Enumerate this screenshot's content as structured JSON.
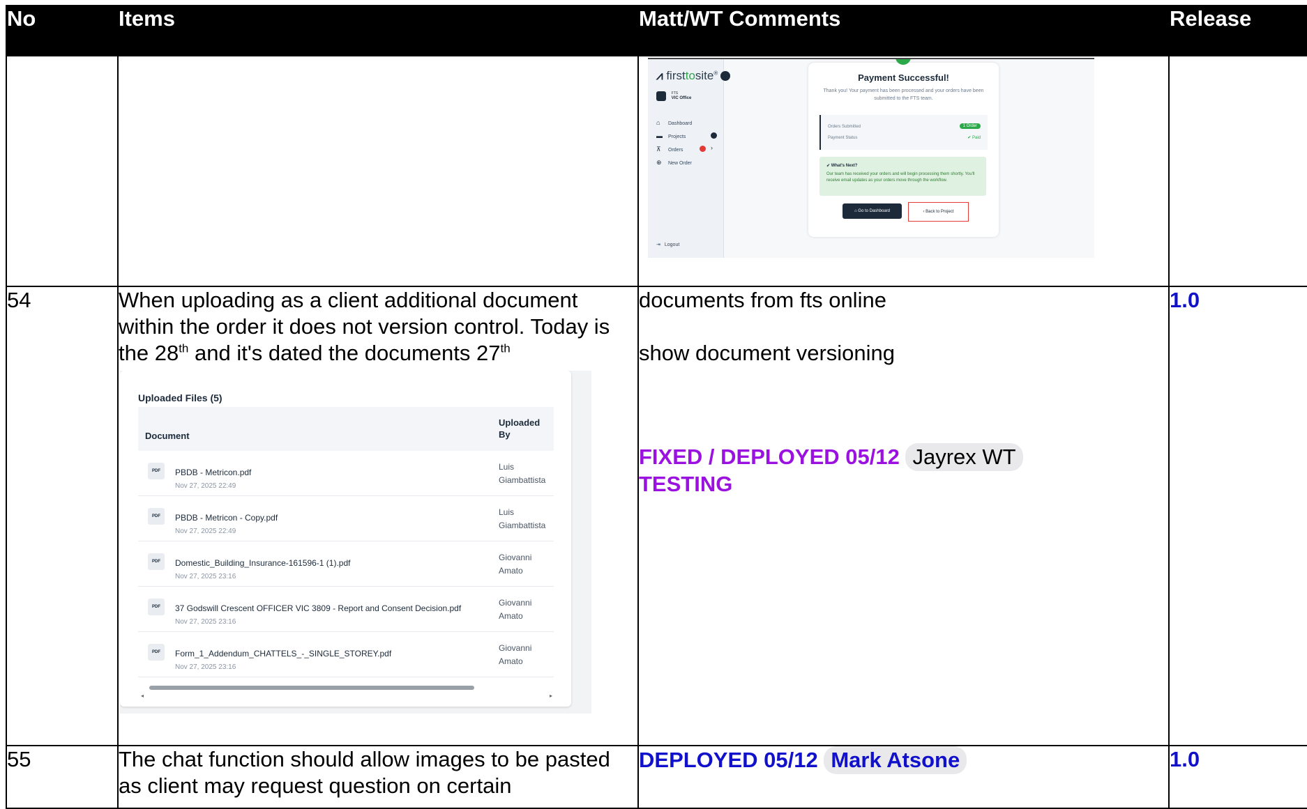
{
  "table": {
    "headers": {
      "no": "No",
      "items": "Items",
      "comments": "Matt/WT Comments",
      "release": "Release"
    }
  },
  "payment_screenshot": {
    "logo_text": "first",
    "logo_accent": "to",
    "logo_rest": "site",
    "logo_reg": "®",
    "office_small": "FTS",
    "office_label": "VIC Office",
    "nav": [
      "Dashboard",
      "Projects",
      "Orders",
      "New Order"
    ],
    "logout": "Logout",
    "title": "Payment Successful!",
    "subtitle": "Thank you! Your payment has been processed and your orders have been submitted to the FTS team.",
    "orders_submitted_label": "Orders Submitted",
    "orders_submitted_value": "1 Order",
    "payment_status_label": "Payment Status",
    "payment_status_value": "Paid",
    "whats_next_title": "What's Next?",
    "whats_next_text": "Our team has received your orders and will begin processing them shortly. You'll receive email updates as your orders move through the workflow.",
    "go_dashboard": "Go to Dashboard",
    "back_project": "Back to Project"
  },
  "rows": [
    {
      "no": "54",
      "item_line1": "When uploading as a client additional document within the order it does not version control. Today is the 28",
      "item_sup1": "th",
      "item_line2": " and it's dated the documents 27",
      "item_sup2": "th",
      "comment1": "documents from fts online",
      "comment2": "show document versioning",
      "status": "FIXED / DEPLOYED 05/12",
      "status_cont": "TESTING",
      "assignee": "Jayrex WT",
      "release": "1.0"
    },
    {
      "no": "55",
      "item": "The chat function should allow images to be pasted as client may request question on certain",
      "status": "DEPLOYED 05/12",
      "assignee": "Mark Atsone",
      "release": "1.0"
    }
  ],
  "files_screenshot": {
    "title": "Uploaded Files (5)",
    "col_document": "Document",
    "col_uploaded_by": "Uploaded By",
    "icon_label": "PDF",
    "files": [
      {
        "name": "PBDB - Metricon.pdf",
        "date": "Nov 27, 2025 22:49",
        "by": "Luis Giambattista"
      },
      {
        "name": "PBDB - Metricon - Copy.pdf",
        "date": "Nov 27, 2025 22:49",
        "by": "Luis Giambattista"
      },
      {
        "name": "Domestic_Building_Insurance-161596-1 (1).pdf",
        "date": "Nov 27, 2025 23:16",
        "by": "Giovanni Amato"
      },
      {
        "name": "37 Godswill Crescent OFFICER VIC 3809 - Report and Consent Decision.pdf",
        "date": "Nov 27, 2025 23:16",
        "by": "Giovanni Amato"
      },
      {
        "name": "Form_1_Addendum_CHATTELS_-_SINGLE_STOREY.pdf",
        "date": "Nov 27, 2025 23:16",
        "by": "Giovanni Amato"
      }
    ]
  },
  "colors": {
    "header_bg": "#000000",
    "release_blue": "#1111cc",
    "status_purple": "#9b12e0",
    "success_green": "#2ba84a"
  }
}
